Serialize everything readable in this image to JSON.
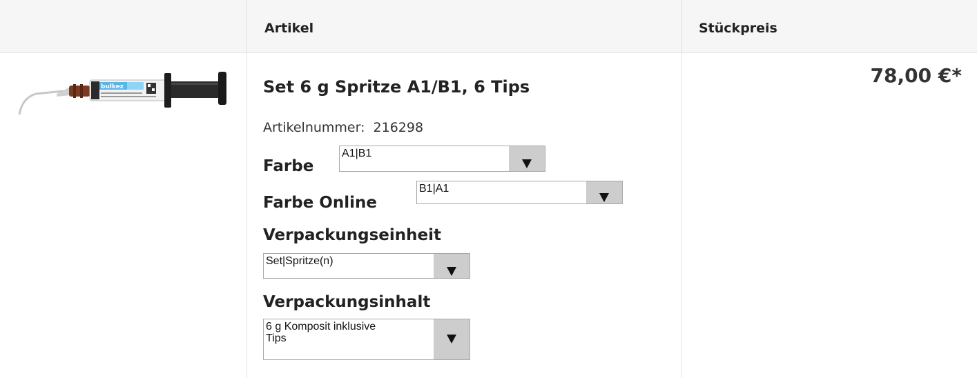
{
  "columns": {
    "artikel": "Artikel",
    "stueckpreis": "Stückpreis"
  },
  "product": {
    "title": "Set 6 g Spritze A1/B1, 6 Tips",
    "artikelnummer_label": "Artikelnummer:",
    "artikelnummer": "216298",
    "price": "78,00 €*",
    "image_brand": "bulk ez PLUS"
  },
  "options": {
    "farbe": {
      "label": "Farbe",
      "value": "A1|B1"
    },
    "farbe_online": {
      "label": "Farbe Online",
      "value": "B1|A1"
    },
    "verpackungseinheit": {
      "label": "Verpackungseinheit",
      "value": "Set|Spritze(n)"
    },
    "verpackungsinhalt": {
      "label": "Verpackungsinhalt",
      "value_line1": "6 g Komposit inklusive",
      "value_line2": "Tips"
    }
  },
  "colors": {
    "header_bg": "#f6f6f6",
    "border": "#e2e2e2",
    "select_arrow_bg": "#cdcdcd",
    "syringe_label": "#5ab4e6"
  }
}
